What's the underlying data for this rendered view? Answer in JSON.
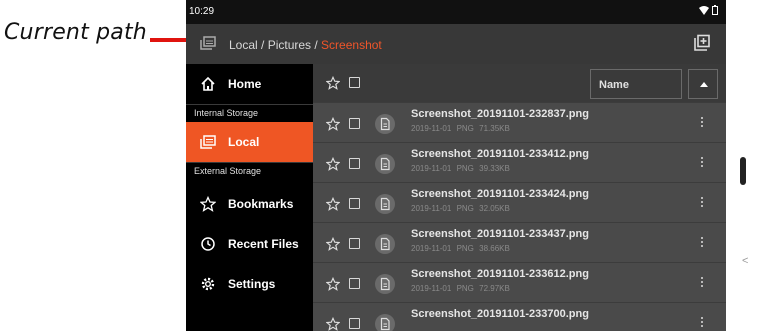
{
  "annotation": {
    "label": "Current path",
    "line_color": "#e0140f"
  },
  "status_bar": {
    "time": "10:29"
  },
  "path_bar": {
    "crumb_prefix": "Local / Pictures / ",
    "current_folder": "Screenshot",
    "folder_icon": "folder-stack-icon",
    "action_icon": "add-box-icon"
  },
  "sidebar": {
    "home": "Home",
    "internal_section": "Internal Storage",
    "local": "Local",
    "external_section": "External Storage",
    "bookmarks": "Bookmarks",
    "recent": "Recent Files",
    "settings": "Settings"
  },
  "toolbar": {
    "sort_field": "Name"
  },
  "files": [
    {
      "name": "Screenshot_20191101-232837.png",
      "date": "2019-11-01",
      "type": "PNG",
      "size": "71.35KB"
    },
    {
      "name": "Screenshot_20191101-233412.png",
      "date": "2019-11-01",
      "type": "PNG",
      "size": "39.33KB"
    },
    {
      "name": "Screenshot_20191101-233424.png",
      "date": "2019-11-01",
      "type": "PNG",
      "size": "32.05KB"
    },
    {
      "name": "Screenshot_20191101-233437.png",
      "date": "2019-11-01",
      "type": "PNG",
      "size": "38.66KB"
    },
    {
      "name": "Screenshot_20191101-233612.png",
      "date": "2019-11-01",
      "type": "PNG",
      "size": "72.97KB"
    },
    {
      "name": "Screenshot_20191101-233700.png",
      "date": "",
      "type": "",
      "size": ""
    }
  ],
  "colors": {
    "accent": "#ef5624",
    "background": "#2e2e2e",
    "sidebar": "#000000"
  }
}
